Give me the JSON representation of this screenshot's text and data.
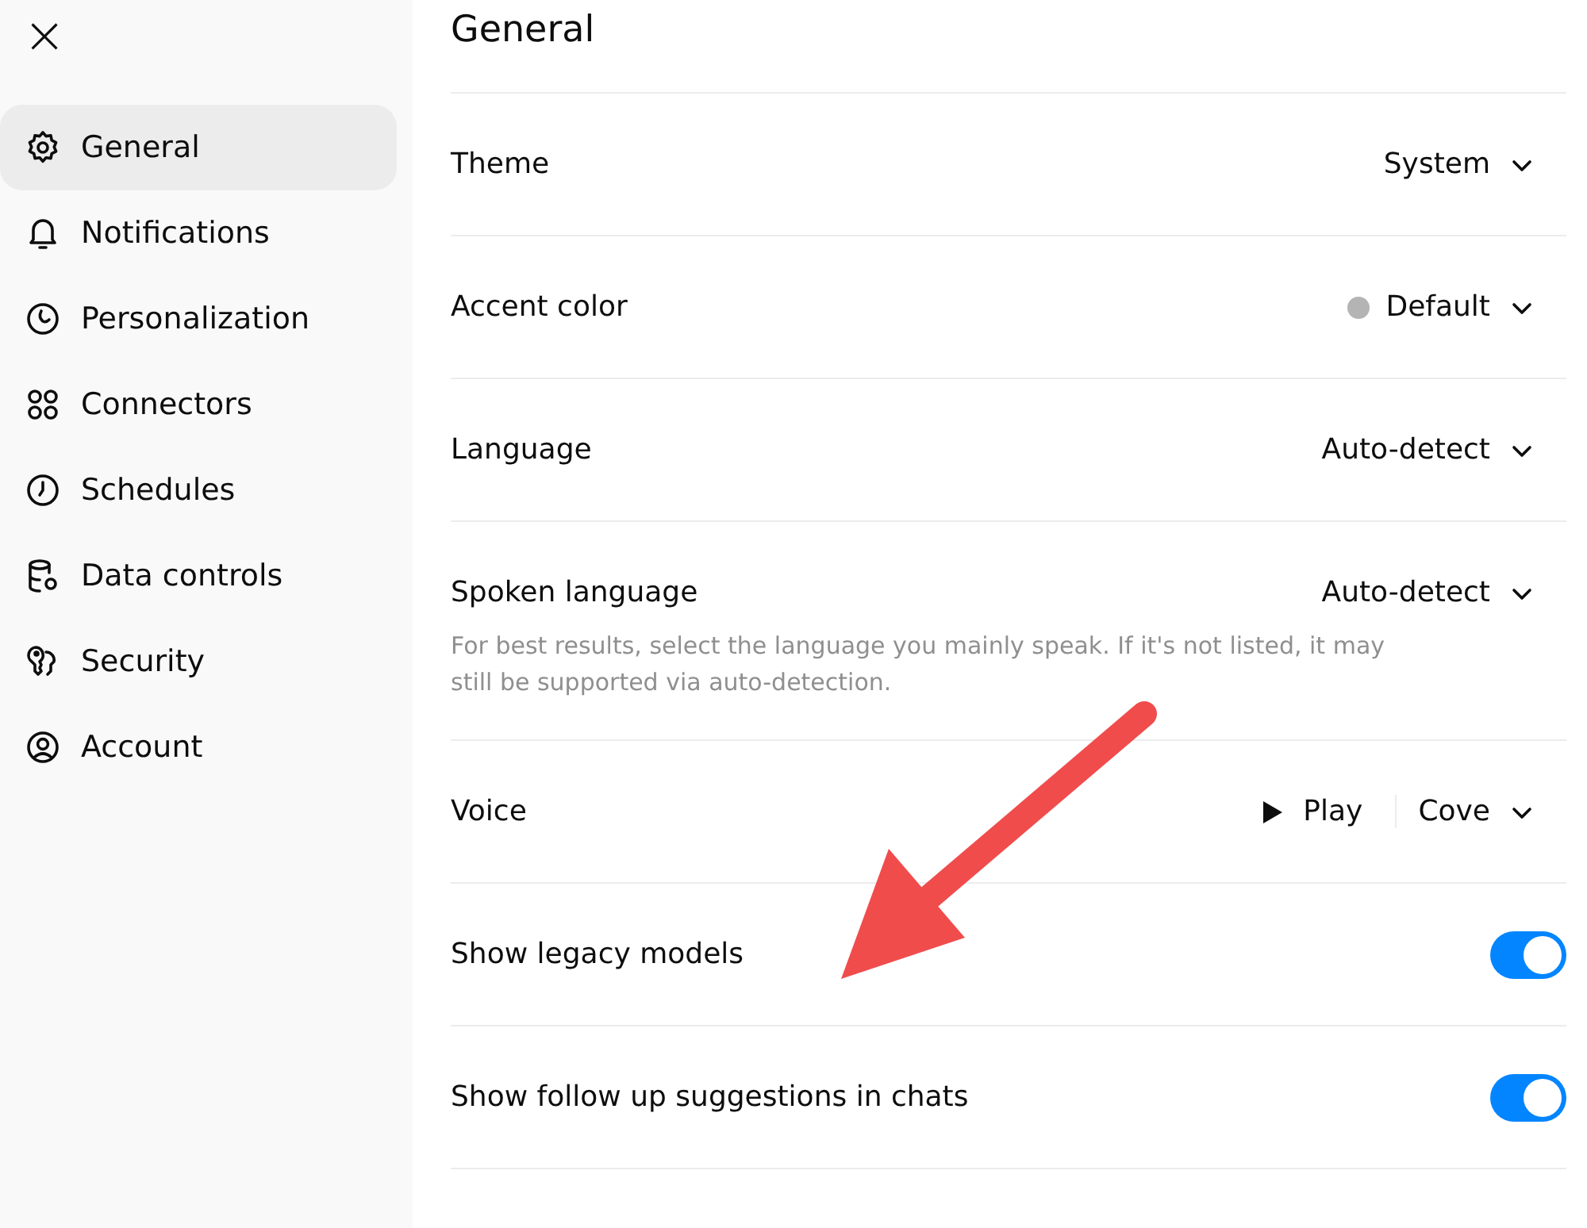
{
  "sidebar": {
    "close_label": "×",
    "items": [
      {
        "label": "General",
        "selected": true
      },
      {
        "label": "Notifications",
        "selected": false
      },
      {
        "label": "Personalization",
        "selected": false
      },
      {
        "label": "Connectors",
        "selected": false
      },
      {
        "label": "Schedules",
        "selected": false
      },
      {
        "label": "Data controls",
        "selected": false
      },
      {
        "label": "Security",
        "selected": false
      },
      {
        "label": "Account",
        "selected": false
      }
    ]
  },
  "main": {
    "title": "General",
    "settings": [
      {
        "kind": "select",
        "label": "Theme",
        "value": "System"
      },
      {
        "kind": "color-select",
        "label": "Accent color",
        "value": "Default",
        "color": "#b4b4b4"
      },
      {
        "kind": "select",
        "label": "Language",
        "value": "Auto-detect"
      },
      {
        "kind": "select",
        "label": "Spoken language",
        "value": "Auto-detect",
        "hint": "For best results, select the language you mainly speak. If it's not listed, it may still be supported via auto-detection."
      },
      {
        "kind": "voice",
        "label": "Voice",
        "play_label": "Play",
        "value": "Cove"
      },
      {
        "kind": "toggle",
        "label": "Show legacy models",
        "on": true
      },
      {
        "kind": "toggle",
        "label": "Show follow up suggestions in chats",
        "on": true
      }
    ]
  },
  "annotation": {
    "kind": "arrow"
  }
}
